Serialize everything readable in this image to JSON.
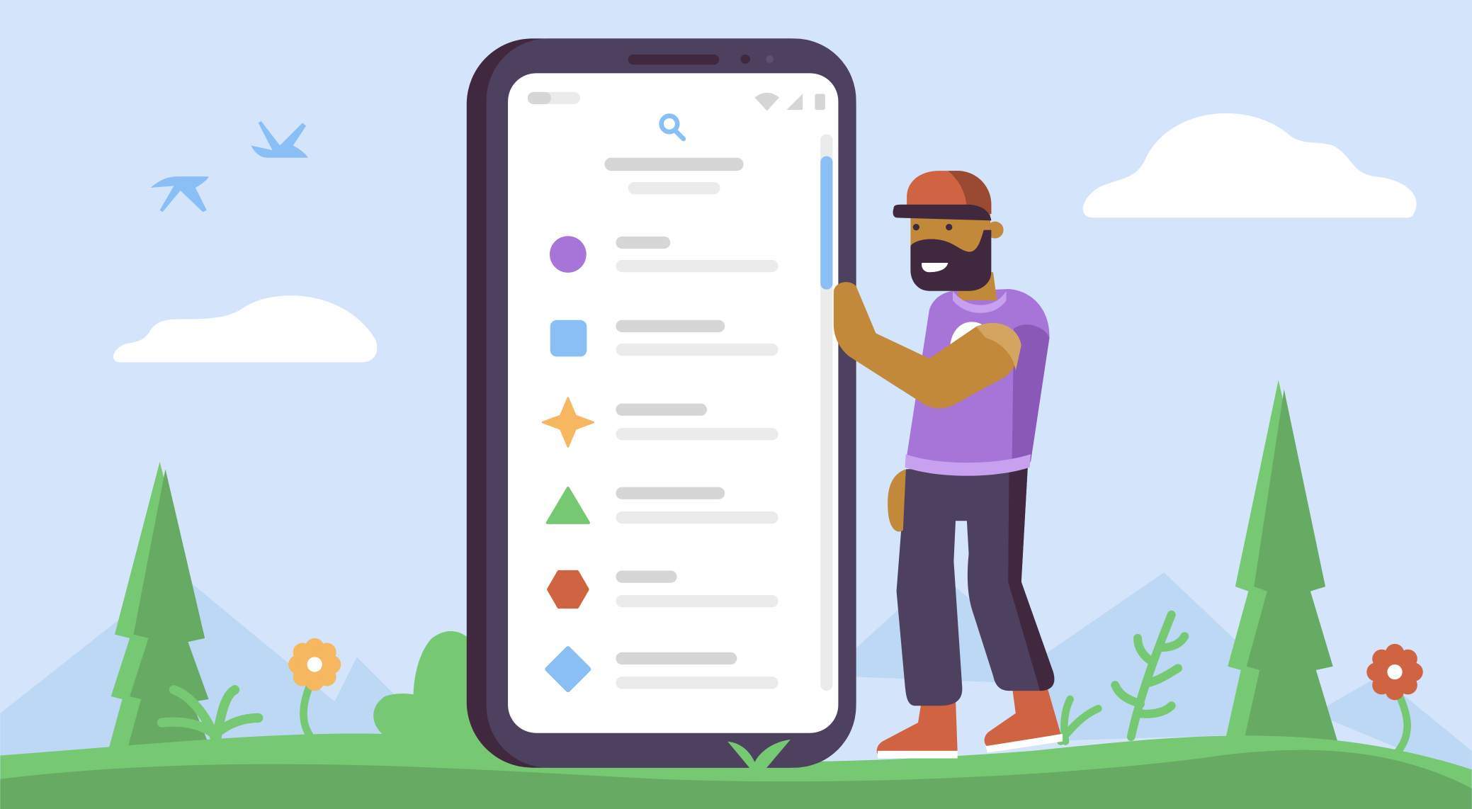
{
  "colors": {
    "sky": "#d4e4fb",
    "mountain": "#bcd8f4",
    "grass_light": "#77c873",
    "grass_dark": "#66aa63",
    "phone_body": "#4e4160",
    "phone_side": "#40283f",
    "screen": "#ffffff",
    "placeholder_dark": "#d6d6d6",
    "placeholder_light": "#ebebeb",
    "accent_blue": "#8abff6",
    "purple": "#a774d8",
    "orange": "#f5b760",
    "green": "#77c873",
    "red": "#d06341",
    "skin": "#c2893b",
    "beard": "#40283f"
  },
  "phone": {
    "status_bar_icons": [
      "wifi-icon",
      "signal-icon",
      "battery-icon"
    ],
    "header_icon": "search-icon",
    "list_items": [
      {
        "icon": "circle-icon",
        "color": "#a774d8"
      },
      {
        "icon": "square-icon",
        "color": "#8abff6"
      },
      {
        "icon": "star-icon",
        "color": "#f5b760"
      },
      {
        "icon": "triangle-icon",
        "color": "#77c873"
      },
      {
        "icon": "hexagon-icon",
        "color": "#d06341"
      },
      {
        "icon": "diamond-icon",
        "color": "#8abff6"
      }
    ],
    "scrollbar_position": 0.2
  },
  "scene": {
    "decorations": [
      "bird-icon",
      "bird-icon",
      "cloud",
      "cloud",
      "tree",
      "tree",
      "flower",
      "flower",
      "plant"
    ]
  }
}
